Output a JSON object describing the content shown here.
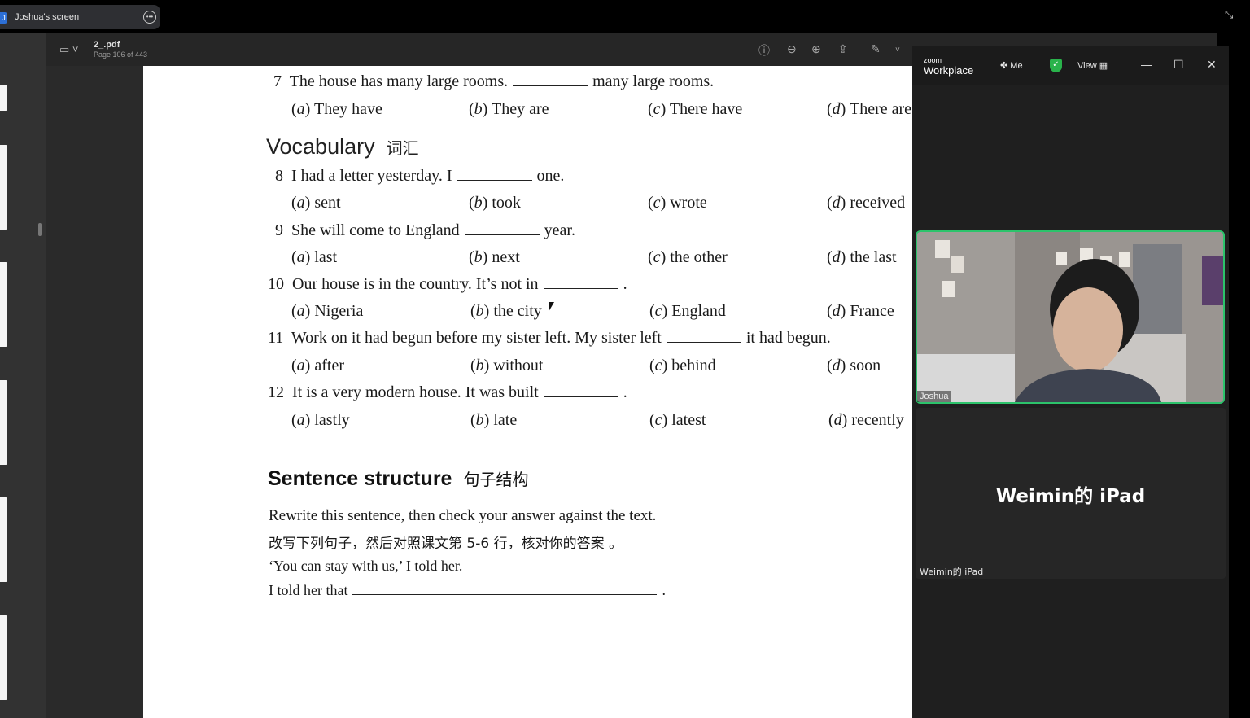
{
  "share_bar": {
    "title": "Joshua's screen",
    "avatar_letter": "J"
  },
  "viewer": {
    "filename": "2_.pdf",
    "page_info": "Page 106 of 443"
  },
  "pdf": {
    "q7": {
      "num": "7",
      "before": "The house has many large rooms.",
      "after": "many large rooms.",
      "options": [
        {
          "letter": "a",
          "text": "They have"
        },
        {
          "letter": "b",
          "text": "They are"
        },
        {
          "letter": "c",
          "text": "There have"
        },
        {
          "letter": "d",
          "text": "There are"
        }
      ]
    },
    "vocab_heading": "Vocabulary",
    "vocab_heading_cn": "词汇",
    "q8": {
      "num": "8",
      "before": "I had a letter yesterday. I",
      "after": "one.",
      "options": [
        {
          "letter": "a",
          "text": "sent"
        },
        {
          "letter": "b",
          "text": "took"
        },
        {
          "letter": "c",
          "text": "wrote"
        },
        {
          "letter": "d",
          "text": "received"
        }
      ]
    },
    "q9": {
      "num": "9",
      "before": "She will come to England",
      "after": "year.",
      "options": [
        {
          "letter": "a",
          "text": "last"
        },
        {
          "letter": "b",
          "text": "next"
        },
        {
          "letter": "c",
          "text": "the other"
        },
        {
          "letter": "d",
          "text": "the last"
        }
      ]
    },
    "q10": {
      "num": "10",
      "before": "Our house is in the country. It’s not in",
      "after": ".",
      "options": [
        {
          "letter": "a",
          "text": "Nigeria"
        },
        {
          "letter": "b",
          "text": "the city"
        },
        {
          "letter": "c",
          "text": "England"
        },
        {
          "letter": "d",
          "text": "France"
        }
      ]
    },
    "q11": {
      "num": "11",
      "before": "Work on it had begun before my sister left. My sister left",
      "after": "it had begun.",
      "options": [
        {
          "letter": "a",
          "text": "after"
        },
        {
          "letter": "b",
          "text": "without"
        },
        {
          "letter": "c",
          "text": "behind"
        },
        {
          "letter": "d",
          "text": "soon"
        }
      ]
    },
    "q12": {
      "num": "12",
      "before": "It is a very modern house. It was built",
      "after": ".",
      "options": [
        {
          "letter": "a",
          "text": "lastly"
        },
        {
          "letter": "b",
          "text": "late"
        },
        {
          "letter": "c",
          "text": "latest"
        },
        {
          "letter": "d",
          "text": "recently"
        }
      ]
    },
    "ss_heading": "Sentence structure",
    "ss_heading_cn": "句子结构",
    "ss_instruction": "Rewrite this sentence, then check your answer against the text.",
    "ss_instruction_cn": "改写下列句子，然后对照课文第 5-6 行，核对你的答案 。",
    "ss_quote": "‘You can stay with us,’ I told her.",
    "ss_answer_prefix": "I told her that",
    "ss_answer_suffix": "."
  },
  "zoom": {
    "logo_small": "zoom",
    "logo": "Workplace",
    "me_label": "Me",
    "view_label": "View",
    "participant_video_name": "Joshua",
    "participant2_big": "Weimin的 iPad",
    "participant2_small": "Weimin的 iPad"
  },
  "colors": {
    "active_speaker": "#2cc36b",
    "shield": "#29b34b"
  }
}
